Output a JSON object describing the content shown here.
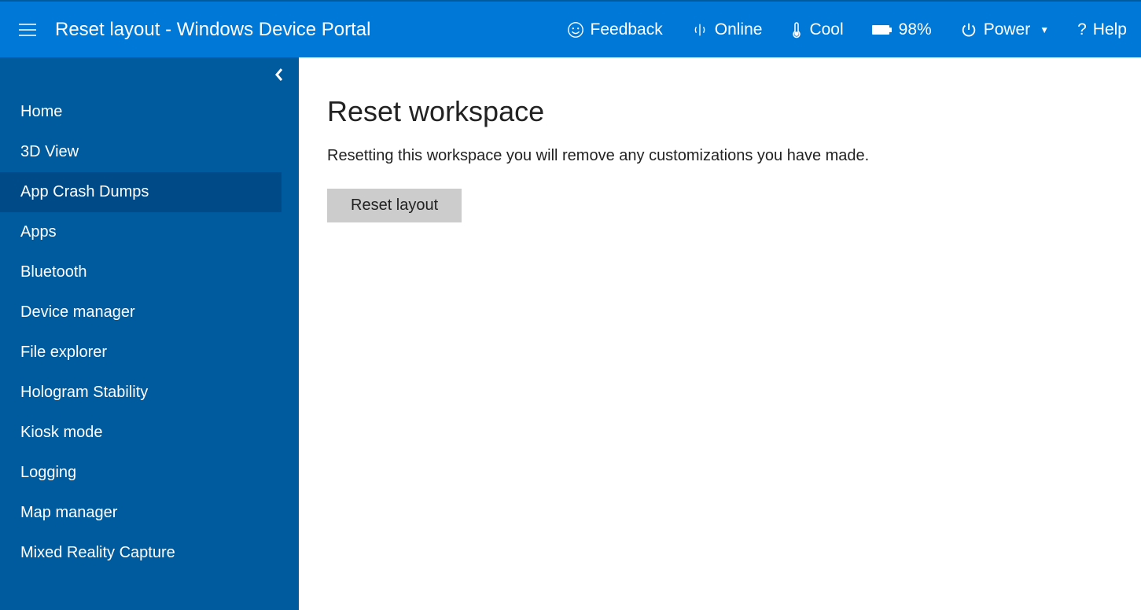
{
  "header": {
    "title": "Reset layout - Windows Device Portal",
    "feedback": "Feedback",
    "online": "Online",
    "cool": "Cool",
    "battery": "98%",
    "power": "Power",
    "help": "Help"
  },
  "sidebar": {
    "items": [
      "Home",
      "3D View",
      "App Crash Dumps",
      "Apps",
      "Bluetooth",
      "Device manager",
      "File explorer",
      "Hologram Stability",
      "Kiosk mode",
      "Logging",
      "Map manager",
      "Mixed Reality Capture"
    ],
    "active_index": 2
  },
  "main": {
    "heading": "Reset workspace",
    "description": "Resetting this workspace you will remove any customizations you have made.",
    "button": "Reset layout"
  }
}
